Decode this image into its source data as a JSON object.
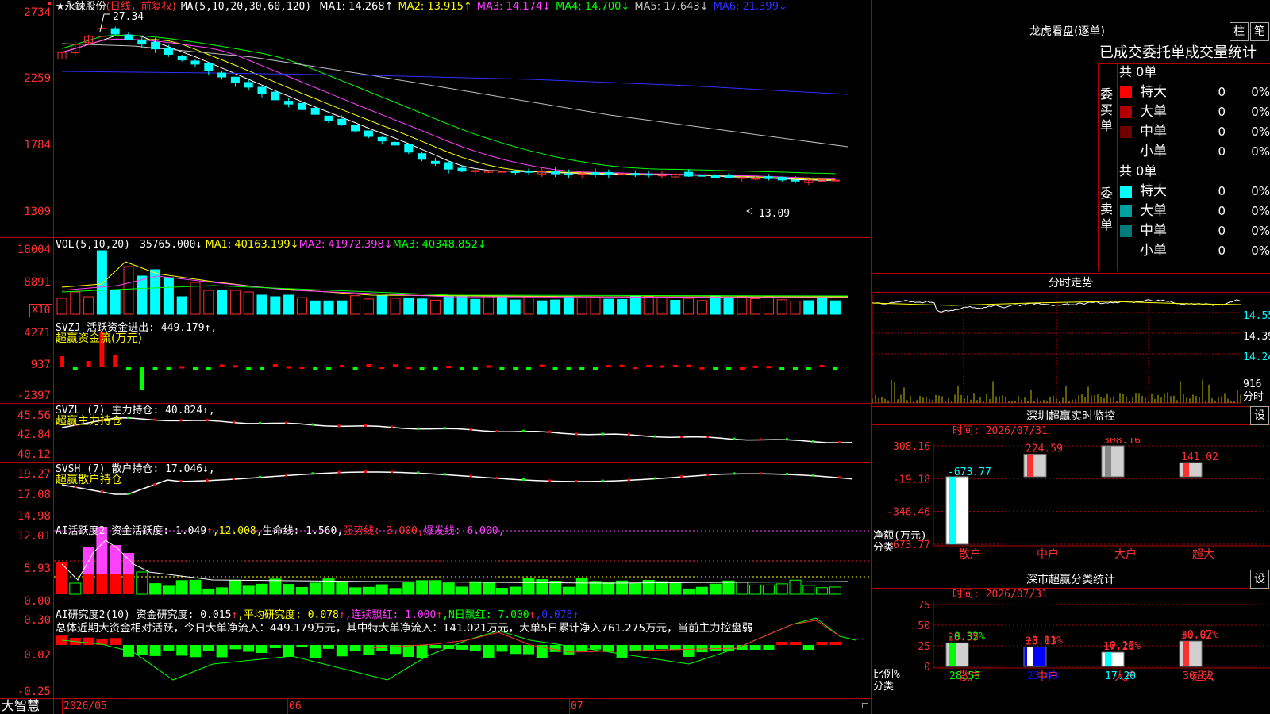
{
  "stock": {
    "title": "★永鍊股份",
    "period": "(日线，前复权)"
  },
  "price_chart": {
    "ma_header": "MA(5,10,20,30,60,120)",
    "ma_values": [
      {
        "text": "MA1: 14.268↑",
        "color": "#ffffff"
      },
      {
        "text": "MA2: 13.915↑",
        "color": "#ffff00"
      },
      {
        "text": "MA3: 14.174↓",
        "color": "#ff40ff"
      },
      {
        "text": "MA4: 14.700↓",
        "color": "#00ff00"
      },
      {
        "text": "MA5: 17.643↓",
        "color": "#c0c0c0"
      },
      {
        "text": "MA6: 21.399↓",
        "color": "#3030ff"
      }
    ],
    "y_ticks": [
      "2734",
      "2259",
      "1784",
      "1309"
    ],
    "high_label": "27.34",
    "low_label": "13.09"
  },
  "volume": {
    "header": "VOL(5,10,20)",
    "value": "35765.000↓",
    "ma": [
      {
        "text": "MA1: 40163.199↓",
        "color": "#ffff00"
      },
      {
        "text": "MA2: 41972.398↓",
        "color": "#ff40ff"
      },
      {
        "text": "MA3: 40348.852↓",
        "color": "#00ff00"
      }
    ],
    "y_ticks": [
      "18004",
      "8891"
    ],
    "unit": "X10"
  },
  "svzj": {
    "header": "SVZJ  活跃资金进出: 449.179↑,",
    "subtitle": "超赢资金流(万元)",
    "y_ticks": [
      "4271",
      "937",
      "-2397"
    ]
  },
  "svzl": {
    "header": "SVZL (7) 主力持仓: 40.824↑,",
    "subtitle": "超赢主力持仓",
    "y_ticks": [
      "45.56",
      "42.84",
      "40.12"
    ]
  },
  "svsh": {
    "header": "SVSH (7) 散户持仓: 17.046↓,",
    "subtitle": "超赢散户持仓",
    "y_ticks": [
      "19.27",
      "17.08",
      "14.98"
    ]
  },
  "ai_active": {
    "parts": [
      {
        "text": "AI活跃度2 资金活跃度: 1.049",
        "color": "#ffffff"
      },
      {
        "text": "↑",
        "color": "#ff3030"
      },
      {
        "text": ",12.008,",
        "color": "#ffff00"
      },
      {
        "text": "生命线: 1.560,",
        "color": "#ffffff"
      },
      {
        "text": "强势线: 3.000,",
        "color": "#ff3030"
      },
      {
        "text": "爆发线: 6.000,",
        "color": "#ff40ff"
      }
    ],
    "y_ticks": [
      "12.01",
      "5.93",
      "0.00"
    ]
  },
  "ai_research": {
    "parts": [
      {
        "text": "AI研究度2(10) 资金研究度: 0.015",
        "color": "#ffffff"
      },
      {
        "text": "↑",
        "color": "#ff3030"
      },
      {
        "text": ",平均研究度: 0.078",
        "color": "#ffff00"
      },
      {
        "text": "↑",
        "color": "#ff3030"
      },
      {
        "text": ",连续飘红: 1.000",
        "color": "#ff40ff"
      },
      {
        "text": "↑",
        "color": "#ff3030"
      },
      {
        "text": ",N日飘红: 7.000",
        "color": "#00ff00"
      },
      {
        "text": "↑",
        "color": "#ff3030"
      },
      {
        "text": ",0.078",
        "color": "#3030ff"
      },
      {
        "text": "↑",
        "color": "#3030ff"
      }
    ],
    "summary": "总体近期大资金相对活跃，今日大单净流入：449.179万元，其中特大单净流入：141.021万元，大单5日累计净入761.275万元，当前主力控盘弱",
    "y_ticks": [
      "0.30",
      "0.02",
      "-0.25"
    ]
  },
  "bottom_bar": {
    "brand": "大智慧",
    "dates": [
      "2026/05",
      "06",
      "07"
    ]
  },
  "dragon_tiger": {
    "title": "龙虎看盘(逐单)",
    "btn_bar": "柱",
    "btn_pen": "笔",
    "tabs_label": "已成交委托单成交量统计",
    "buy": {
      "side_label": "委买单",
      "total": "共 0单",
      "rows": [
        {
          "name": "特大",
          "count": "0",
          "pct": "0%",
          "color": "#ff0000"
        },
        {
          "name": "大单",
          "count": "0",
          "pct": "0%",
          "color": "#b00000"
        },
        {
          "name": "中单",
          "count": "0",
          "pct": "0%",
          "color": "#700000"
        },
        {
          "name": "小单",
          "count": "0",
          "pct": "0%",
          "color": "#000000"
        }
      ]
    },
    "sell": {
      "side_label": "委卖单",
      "total": "共 0单",
      "rows": [
        {
          "name": "特大",
          "count": "0",
          "pct": "0%",
          "color": "#00ffff"
        },
        {
          "name": "大单",
          "count": "0",
          "pct": "0%",
          "color": "#00a0a0"
        },
        {
          "name": "中单",
          "count": "0",
          "pct": "0%",
          "color": "#007a7a"
        },
        {
          "name": "小单",
          "count": "0",
          "pct": "0%",
          "color": "#000000"
        }
      ]
    }
  },
  "intraday": {
    "title": "分时走势",
    "y_labels": [
      "14.55",
      "14.39",
      "14.24"
    ],
    "vol_label": "916",
    "vol_caption": "分时"
  },
  "sz_monitor": {
    "title": "深圳超赢实时监控",
    "settings_btn": "设",
    "time_label": "时间: 2026/07/31",
    "y_ticks": [
      "308.16",
      "-19.18",
      "-346.46",
      "-673.77"
    ],
    "ylabel_1": "净额(万元)",
    "ylabel_2": "分类",
    "chart_data": {
      "type": "bar",
      "categories": [
        "散户",
        "中户",
        "大户",
        "超大"
      ],
      "values": [
        -673.77,
        224.59,
        308.16,
        141.02
      ],
      "value_labels": [
        "-673.77",
        "224.59",
        "308.16",
        "141.02"
      ],
      "ylim": [
        -673.77,
        308.16
      ]
    }
  },
  "sz_class": {
    "title": "深市超赢分类统计",
    "settings_btn": "设",
    "time_label": "时间: 2026/07/31",
    "y_ticks": [
      "75",
      "50",
      "25",
      "0"
    ],
    "ylabel_1": "比例%",
    "ylabel_2": "分类",
    "chart_data": {
      "type": "bar",
      "categories": [
        "散户",
        "中户",
        "大户",
        "超大"
      ],
      "values": [
        28.55,
        23.63,
        17.2,
        30.62
      ],
      "value_labels": [
        "28.55",
        "23.63",
        "17.20",
        "30.62"
      ],
      "changes": [
        "-0.32%",
        "+0.11%",
        "+0.15%",
        "+0.07%"
      ],
      "ylim": [
        0,
        75
      ]
    }
  }
}
